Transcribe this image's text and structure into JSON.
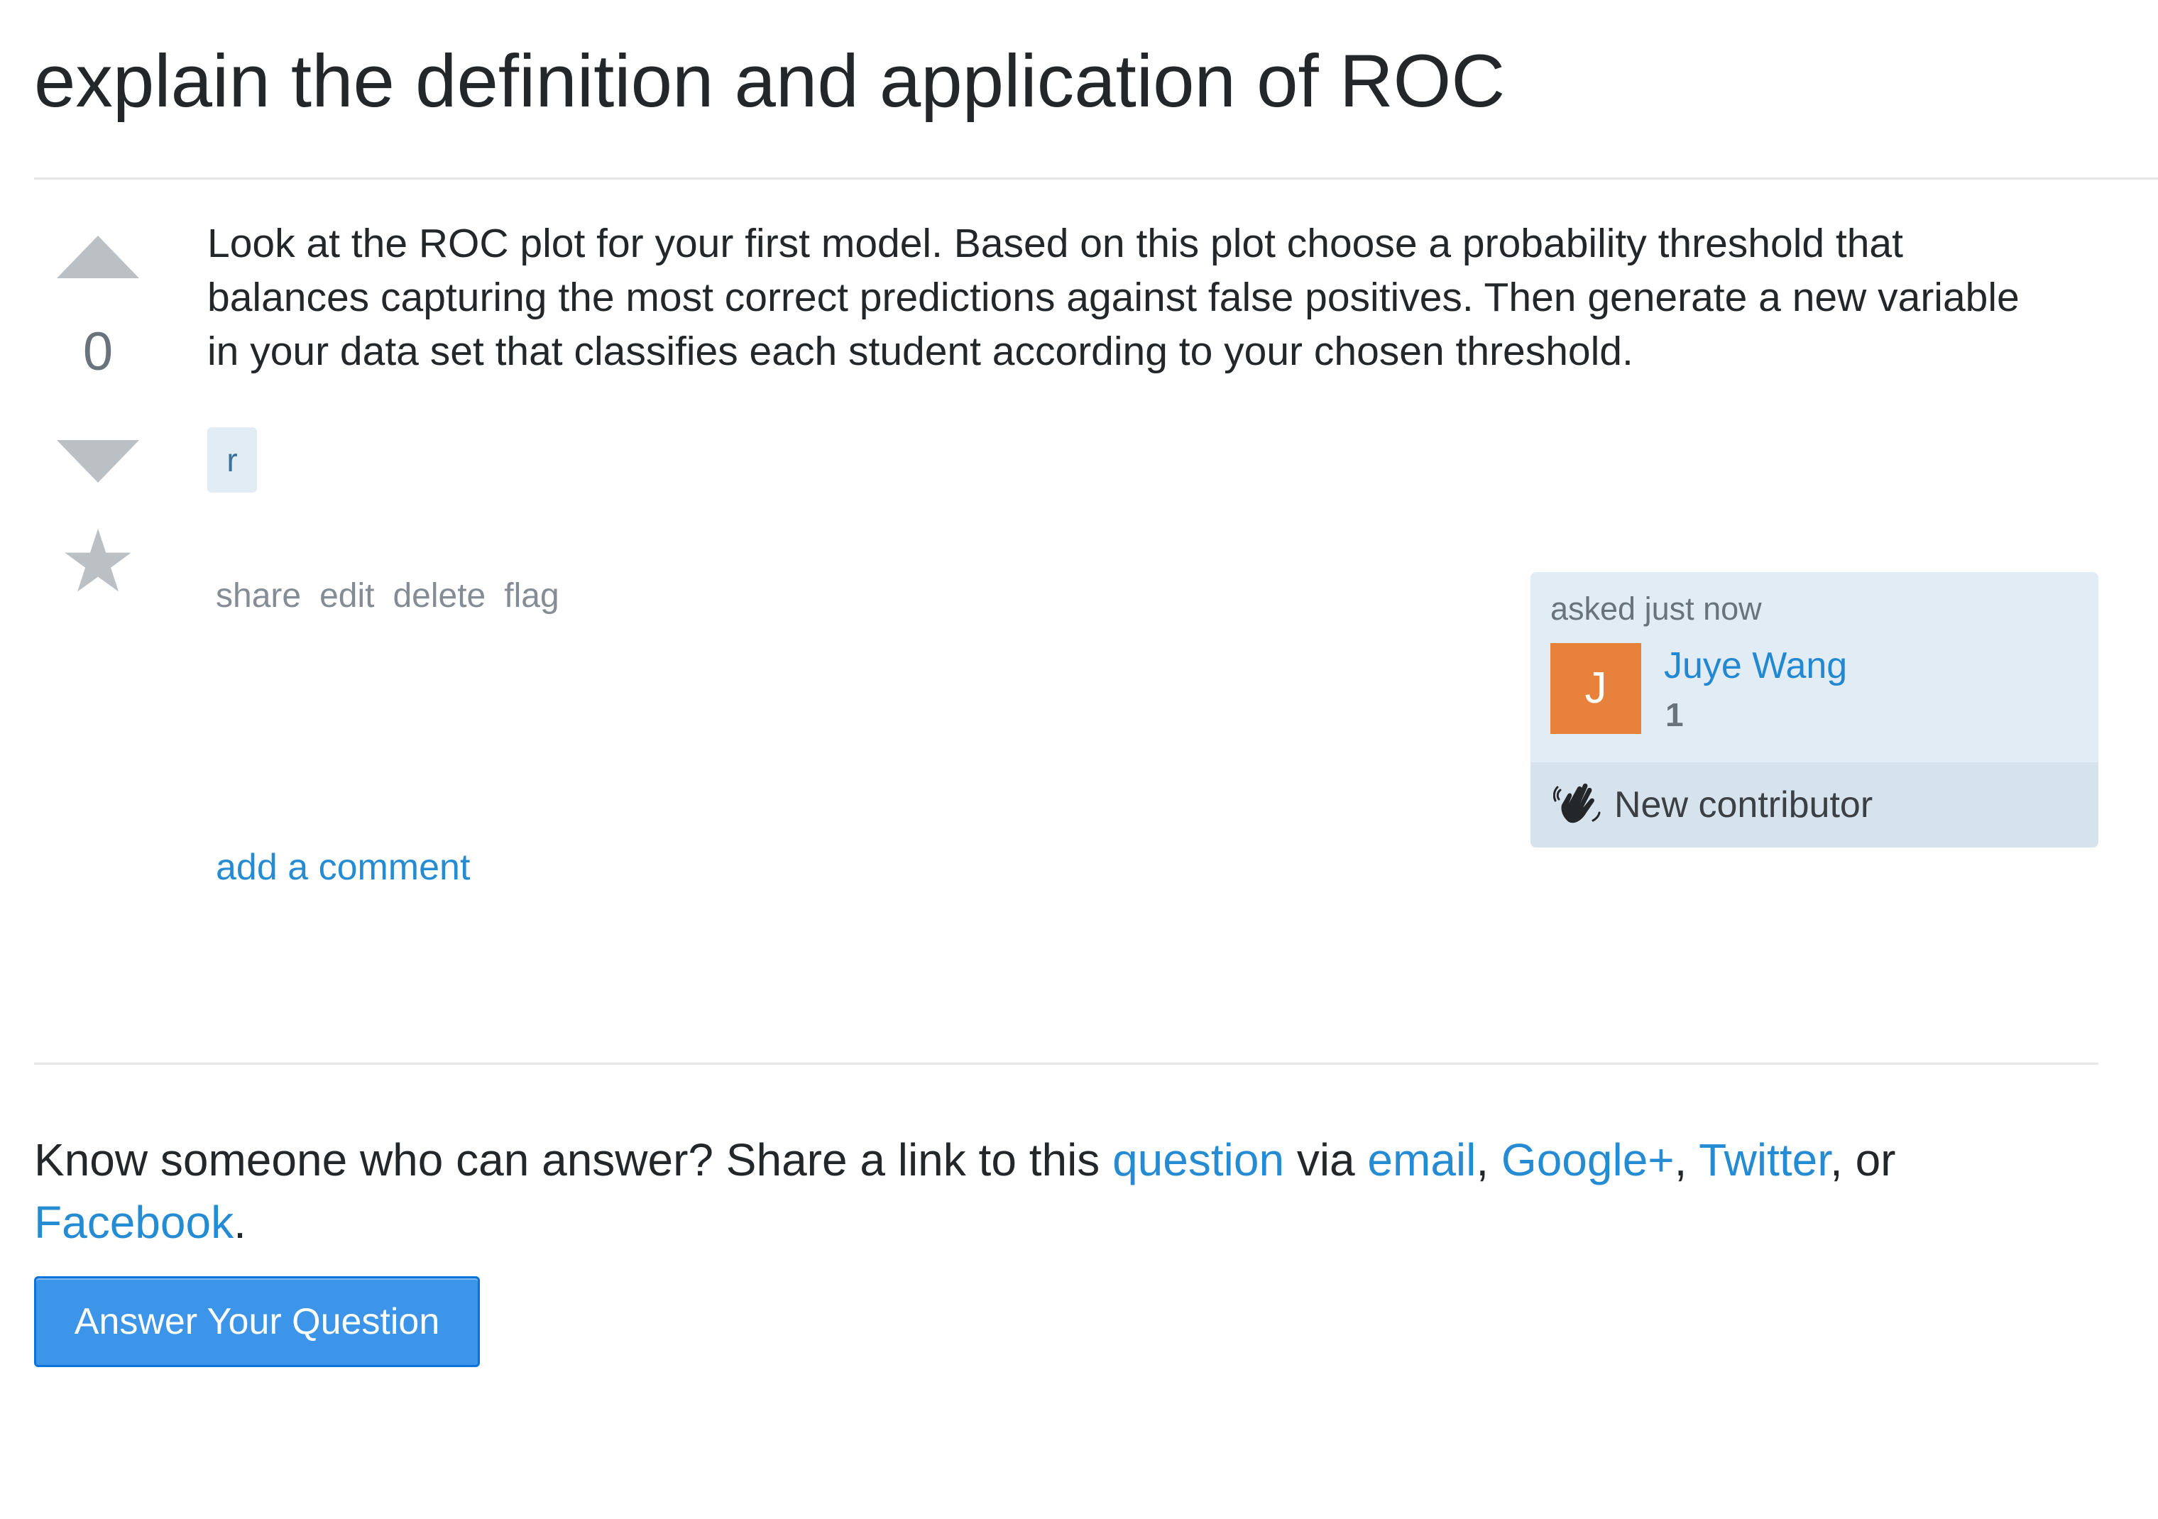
{
  "question": {
    "title": "explain the definition and application of ROC",
    "vote_count": "0",
    "body": "Look at the ROC plot for your first model. Based on this plot choose a probability threshold that balances capturing the most correct predictions against false positives. Then generate a new variable in your data set that classifies each student according to your chosen threshold.",
    "tags": [
      "r"
    ]
  },
  "post_menu": {
    "share": "share",
    "edit": "edit",
    "delete": "delete",
    "flag": "flag"
  },
  "user_card": {
    "asked": "asked just now",
    "avatar_letter": "J",
    "avatar_color": "#e8813b",
    "name": "Juye Wang",
    "reputation": "1",
    "contributor_label": "New contributor",
    "contributor_icon": "waving-hand-icon"
  },
  "comments": {
    "add_comment": "add a comment"
  },
  "share_prompt": {
    "text_before": "Know someone who can answer? Share a link to this ",
    "question_link": "question",
    "via": " via ",
    "email_link": "email",
    "sep1": ", ",
    "google_link": "Google+",
    "sep2": ", ",
    "twitter_link": "Twitter",
    "or": ", or ",
    "facebook_link": "Facebook",
    "end": "."
  },
  "answer_button": "Answer Your Question",
  "colors": {
    "link": "#0077cc",
    "button": "#3d95ea",
    "tag_bg": "#e1ecf4",
    "card_bg": "#e1ecf4"
  }
}
